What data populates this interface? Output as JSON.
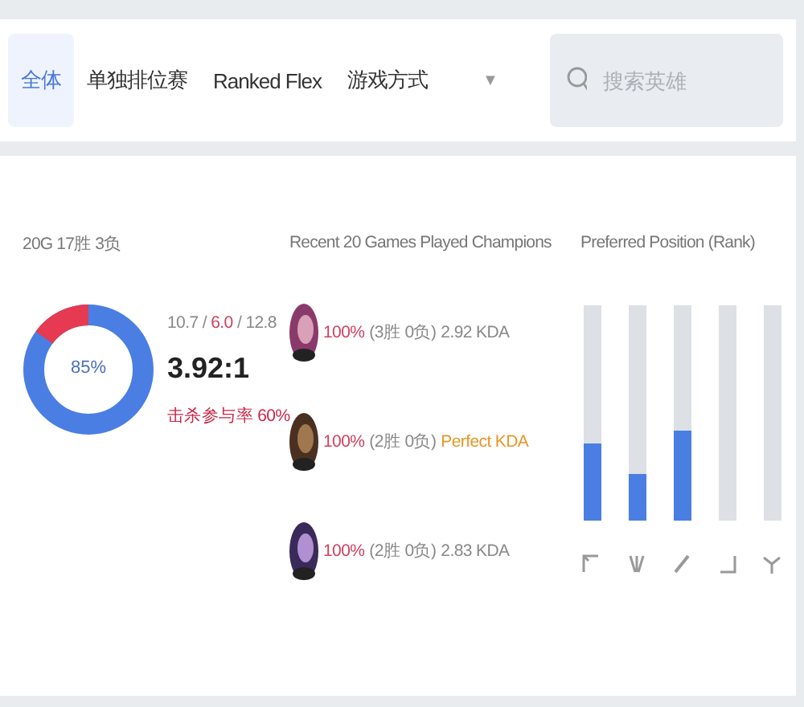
{
  "tabs": [
    {
      "label": "全体",
      "selected": true
    },
    {
      "label": "单独排位赛",
      "selected": false
    },
    {
      "label": "Ranked Flex",
      "selected": false
    },
    {
      "label": "游戏方式",
      "selected": false,
      "caret": "▼"
    }
  ],
  "search": {
    "placeholder": "搜索英雄"
  },
  "summary": {
    "record": "20G 17胜 3负",
    "donut": {
      "label": "85%"
    },
    "kda_line": {
      "kills": "10.7",
      "deaths": "6.0",
      "assists": "12.8",
      "separator": "/"
    },
    "ratio": "3.92:1",
    "kill_participation": "击杀参与率 60%"
  },
  "champions": {
    "title": "Recent 20 Games Played Champions",
    "rows": [
      {
        "win_rate": "100%",
        "record": "(3胜 0负)",
        "kda": "2.92 KDA",
        "perfect": false
      },
      {
        "win_rate": "100%",
        "record": "(2胜 0负)",
        "kda": "Perfect KDA",
        "perfect": true
      },
      {
        "win_rate": "100%",
        "record": "(2胜 0负)",
        "kda": "2.83 KDA",
        "perfect": false
      }
    ]
  },
  "positions": {
    "title": "Preferred Position (Rank)",
    "items": [
      {
        "kind": "top",
        "level": 0.36
      },
      {
        "kind": "jungle",
        "level": 0.22
      },
      {
        "kind": "mid",
        "level": 0.42
      },
      {
        "kind": "bottom"
      },
      {
        "kind": "support"
      }
    ]
  }
}
